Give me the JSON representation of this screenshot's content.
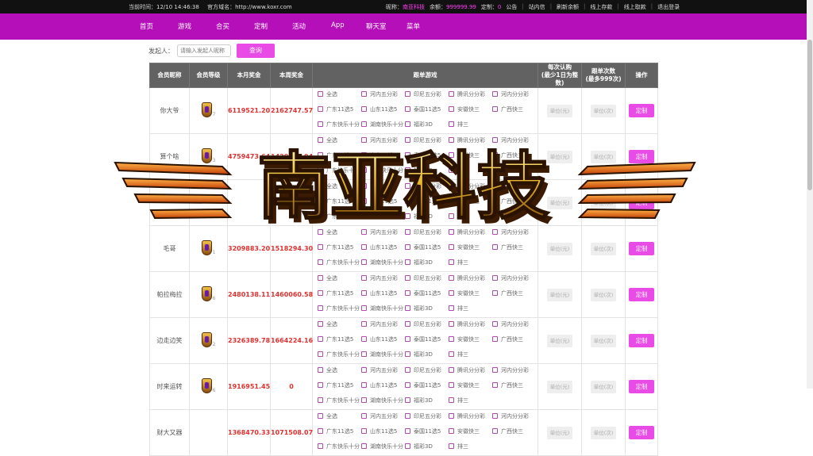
{
  "topbar": {
    "time": "当前时间：12/10 14:46:38",
    "site": "官方域名：http://www.koxr.com",
    "nickname_label": "昵称：",
    "nickname": "南亚科技",
    "balance_label": "余额：",
    "balance": "999999.99",
    "custom_label": "定制：",
    "custom_count": "0",
    "links": [
      "公告",
      "站内信",
      "刷新余额",
      "线上存款",
      "线上取款",
      "退出登录"
    ]
  },
  "nav": [
    "首页",
    "游戏",
    "合买",
    "定制",
    "活动",
    "App",
    "聊天室",
    "菜单"
  ],
  "search": {
    "label": "发起人：",
    "placeholder": "请输入发起人昵称",
    "button": "查询"
  },
  "table": {
    "headers": [
      "会员昵称",
      "会员等级",
      "本月奖金",
      "本周奖金",
      "跟单游戏",
      "每次认购\n(最少1日为整数)",
      "跟单次数\n(最多999次)",
      "操作"
    ],
    "games": [
      "全选",
      "河内五分彩",
      "印尼五分彩",
      "腾讯分分彩",
      "河内分分彩",
      "广东11选5",
      "山东11选5",
      "泰国11选5",
      "安徽快三",
      "广西快三",
      "广东快乐十分",
      "湖南快乐十分",
      "福彩3D",
      "排三"
    ],
    "unit_placeholder": "单位(元)",
    "times_placeholder": "单位(次)",
    "action": "定制",
    "rows": [
      {
        "nick": "你大爷",
        "level": "7",
        "month": "6119521.20",
        "week": "2162747.57"
      },
      {
        "nick": "算个啥",
        "level": "3",
        "month": "4759473.64",
        "week": "1420516.94"
      },
      {
        "nick": "",
        "level": "",
        "month": "",
        "week": ""
      },
      {
        "nick": "毛哥",
        "level": "1",
        "month": "3209883.20",
        "week": "1518294.30"
      },
      {
        "nick": "帕拉梅拉",
        "level": "6",
        "month": "2480138.11",
        "week": "1460060.58"
      },
      {
        "nick": "边走边笑",
        "level": "2",
        "month": "2326389.78",
        "week": "1664224.16"
      },
      {
        "nick": "时来运转",
        "level": "6",
        "month": "1916951.45",
        "week": "0"
      },
      {
        "nick": "财大又器",
        "level": "",
        "month": "1368470.33",
        "week": "1071508.07"
      }
    ]
  },
  "watermark": "南亚科技",
  "colors": {
    "nav": "#b40fb8",
    "accent": "#e94be7",
    "money": "#e0312f",
    "header": "#626262"
  }
}
